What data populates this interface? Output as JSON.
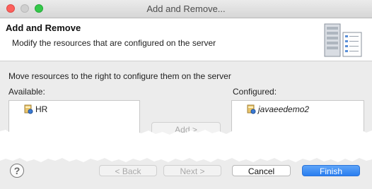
{
  "window": {
    "title": "Add and Remove..."
  },
  "header": {
    "title": "Add and Remove",
    "subtitle": "Modify the resources that are configured on the server",
    "icon": "server-icon"
  },
  "main": {
    "instruction": "Move resources to the right to configure them on the server",
    "available": {
      "label": "Available:",
      "items": [
        {
          "label": "HR",
          "icon": "project-icon"
        }
      ]
    },
    "configured": {
      "label": "Configured:",
      "items": [
        {
          "label": "javaeedemo2",
          "icon": "project-icon"
        }
      ]
    },
    "add_button_label": "Add >"
  },
  "footer": {
    "help_label": "?",
    "back_label": "< Back",
    "next_label": "Next >",
    "cancel_label": "Cancel",
    "finish_label": "Finish"
  },
  "colors": {
    "finish_button": "#2a7ef0",
    "close": "#fc605c",
    "maximize": "#34c84a"
  }
}
